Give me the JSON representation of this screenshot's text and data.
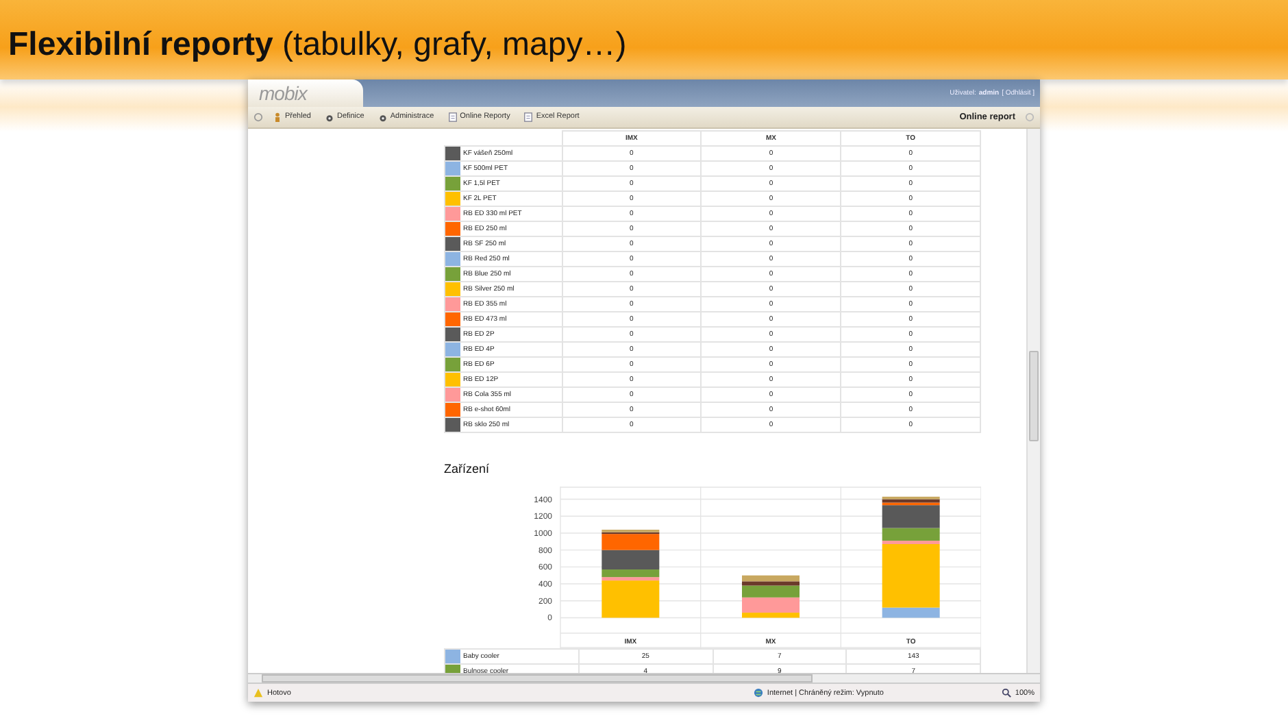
{
  "slide_title": "**Flexibilní reporty** (tabulky, grafy, mapy…)",
  "window": {
    "logo": "mobix",
    "user_label": "Uživatel:",
    "user": "admin",
    "logout": "[ Odhlásit ]",
    "menu": [
      {
        "label": "Přehled",
        "kind": "person"
      },
      {
        "label": "Definice",
        "kind": "gear"
      },
      {
        "label": "Administrace",
        "kind": "gear"
      },
      {
        "label": "Online Reporty",
        "kind": "document"
      },
      {
        "label": "Excel Report",
        "kind": "document"
      }
    ],
    "page_title": "Online report",
    "products_table": {
      "columns": [
        "IMX",
        "MX",
        "TO"
      ],
      "rows": [
        {
          "name": "KF vášeň 250ml",
          "color": "#5a5a5a",
          "values": [
            "0",
            "0",
            "0"
          ]
        },
        {
          "name": "KF 500ml PET",
          "color": "#8db4e2",
          "values": [
            "0",
            "0",
            "0"
          ]
        },
        {
          "name": "KF 1,5l PET",
          "color": "#77a13a",
          "values": [
            "0",
            "0",
            "0"
          ]
        },
        {
          "name": "KF 2L PET",
          "color": "#ffc000",
          "values": [
            "0",
            "0",
            "0"
          ]
        },
        {
          "name": "RB ED 330 ml PET",
          "color": "#ff9999",
          "values": [
            "0",
            "0",
            "0"
          ]
        },
        {
          "name": "RB ED 250 ml",
          "color": "#ff6600",
          "values": [
            "0",
            "0",
            "0"
          ]
        },
        {
          "name": "RB SF 250 ml",
          "color": "#5a5a5a",
          "values": [
            "0",
            "0",
            "0"
          ]
        },
        {
          "name": "RB Red 250 ml",
          "color": "#8db4e2",
          "values": [
            "0",
            "0",
            "0"
          ]
        },
        {
          "name": "RB Blue 250 ml",
          "color": "#77a13a",
          "values": [
            "0",
            "0",
            "0"
          ]
        },
        {
          "name": "RB Silver 250 ml",
          "color": "#ffc000",
          "values": [
            "0",
            "0",
            "0"
          ]
        },
        {
          "name": "RB ED 355 ml",
          "color": "#ff9999",
          "values": [
            "0",
            "0",
            "0"
          ]
        },
        {
          "name": "RB ED 473 ml",
          "color": "#ff6600",
          "values": [
            "0",
            "0",
            "0"
          ]
        },
        {
          "name": "RB ED 2P",
          "color": "#5a5a5a",
          "values": [
            "0",
            "0",
            "0"
          ]
        },
        {
          "name": "RB ED 4P",
          "color": "#8db4e2",
          "values": [
            "0",
            "0",
            "0"
          ]
        },
        {
          "name": "RB ED 6P",
          "color": "#77a13a",
          "values": [
            "0",
            "0",
            "0"
          ]
        },
        {
          "name": "RB ED 12P",
          "color": "#ffc000",
          "values": [
            "0",
            "0",
            "0"
          ]
        },
        {
          "name": "RB Cola 355 ml",
          "color": "#ff9999",
          "values": [
            "0",
            "0",
            "0"
          ]
        },
        {
          "name": "RB e-shot 60ml",
          "color": "#ff6600",
          "values": [
            "0",
            "0",
            "0"
          ]
        },
        {
          "name": "RB sklo 250 ml",
          "color": "#5a5a5a",
          "values": [
            "0",
            "0",
            "0"
          ]
        }
      ]
    },
    "devices": {
      "heading": "Zařízení",
      "chart_data": {
        "type": "bar",
        "stacked": true,
        "grid": true,
        "categories": [
          "IMX",
          "MX",
          "TO"
        ],
        "ylim": [
          -150,
          1550
        ],
        "yticks": [
          0,
          200,
          400,
          600,
          800,
          1000,
          1200,
          1400
        ],
        "series": [
          {
            "color": "#8db4e2",
            "values": [
              0,
              0,
              120
            ]
          },
          {
            "color": "#ffc000",
            "values": [
              440,
              60,
              750
            ]
          },
          {
            "color": "#ff9999",
            "values": [
              40,
              180,
              40
            ]
          },
          {
            "color": "#77a13a",
            "values": [
              90,
              140,
              150
            ]
          },
          {
            "color": "#595959",
            "values": [
              230,
              0,
              270
            ]
          },
          {
            "color": "#ff6600",
            "values": [
              190,
              0,
              30
            ]
          },
          {
            "color": "#6b3a2a",
            "values": [
              20,
              50,
              40
            ]
          },
          {
            "color": "#c8a860",
            "values": [
              30,
              70,
              30
            ]
          }
        ]
      },
      "rows": [
        {
          "name": "Baby cooler",
          "color": "#8db4e2",
          "values": [
            "25",
            "7",
            "143"
          ]
        },
        {
          "name": "Bulnose cooler",
          "color": "#77a13a",
          "values": [
            "4",
            "9",
            "7"
          ]
        }
      ]
    },
    "status_bar": {
      "status": "Hotovo",
      "zone": "Internet | Chráněný režim: Vypnuto",
      "zoom": "100%"
    }
  }
}
